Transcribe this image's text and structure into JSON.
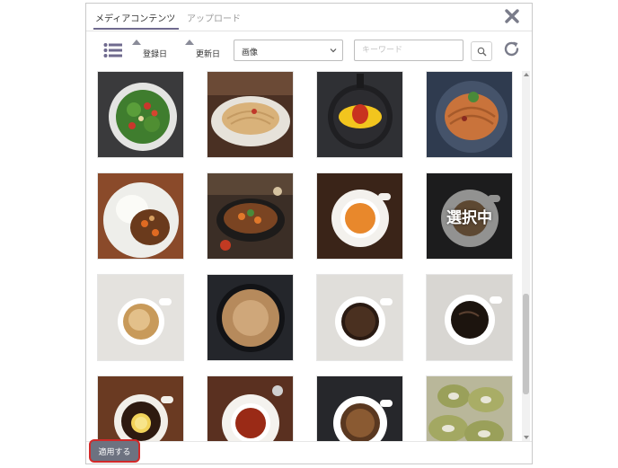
{
  "tabs": [
    {
      "label": "メディアコンテンツ",
      "active": true
    },
    {
      "label": "アップロード",
      "active": false
    }
  ],
  "toolbar": {
    "sort_registered": "登録日",
    "sort_updated": "更新日",
    "type_select": {
      "value": "画像"
    },
    "search": {
      "placeholder": "キーワード"
    }
  },
  "icons": {
    "close": "close-icon",
    "list": "list-icon",
    "search": "search-icon",
    "refresh": "refresh-icon",
    "sort": "triangle-up-icon",
    "select": "chevron-down-icon"
  },
  "grid": {
    "items": [
      {
        "label": "salad"
      },
      {
        "label": "pasta"
      },
      {
        "label": "omelette-rice"
      },
      {
        "label": "spaghetti"
      },
      {
        "label": "curry-rice"
      },
      {
        "label": "stew"
      },
      {
        "label": "tea"
      },
      {
        "label": "coffee-selected",
        "badge": "選択中"
      },
      {
        "label": "cappuccino"
      },
      {
        "label": "latte"
      },
      {
        "label": "black-coffee"
      },
      {
        "label": "black-coffee-2"
      },
      {
        "label": "lemon-tea"
      },
      {
        "label": "red-tea"
      },
      {
        "label": "coffee-cup"
      },
      {
        "label": "green-bagels"
      }
    ]
  },
  "footer": {
    "apply_label": "適用する"
  },
  "colors": {
    "accent": "#6f6a8e",
    "apply_button": "#6d7280",
    "highlight": "#d12a2a"
  }
}
